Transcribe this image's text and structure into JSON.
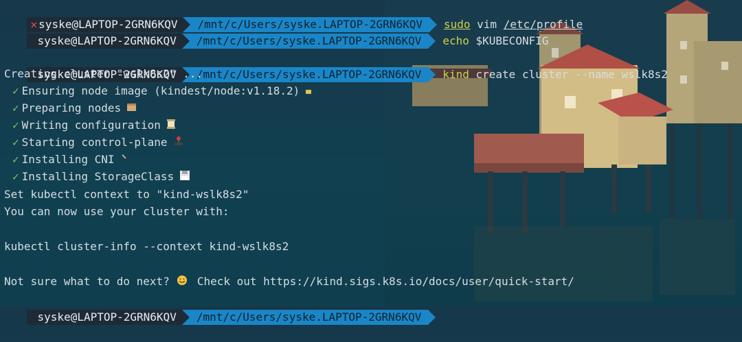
{
  "prompt": {
    "user_host": "syske@LAPTOP-2GRN6KQV",
    "path": "/mnt/c/Users/syske.LAPTOP-2GRN6KQV"
  },
  "lines": {
    "l1_cmd": "sudo",
    "l1_arg1": "vim",
    "l1_arg2": "/etc/profile",
    "l2_cmd": "echo",
    "l2_arg": "$KUBECONFIG",
    "l3_cmd": "kind",
    "l3_arg": "create cluster --name wslk8s2",
    "creating": "Creating cluster \"wslk8s2\" ...",
    "steps": [
      "Ensuring node image (kindest/node:v1.18.2)",
      "Preparing nodes",
      "Writing configuration",
      "Starting control-plane",
      "Installing CNI",
      "Installing StorageClass"
    ],
    "check_mark": "✓",
    "context": "Set kubectl context to \"kind-wslk8s2\"",
    "use_cluster": "You can now use your cluster with:",
    "cluster_info": "kubectl cluster-info --context kind-wslk8s2",
    "not_sure": "Not sure what to do next?",
    "check_out": "Check out https://kind.sigs.k8s.io/docs/user/quick-start/"
  },
  "colors": {
    "prompt_user_bg": "#1e2b37",
    "prompt_path_bg": "#1a86c7",
    "command_color": "#cfd14e",
    "check_color": "#7ac96a",
    "error_x": "#e0524b"
  },
  "icons": [
    "error-x-icon",
    "box-icon",
    "package-icon",
    "scroll-icon",
    "joystick-icon",
    "plug-icon",
    "floppy-icon",
    "smile-icon"
  ]
}
